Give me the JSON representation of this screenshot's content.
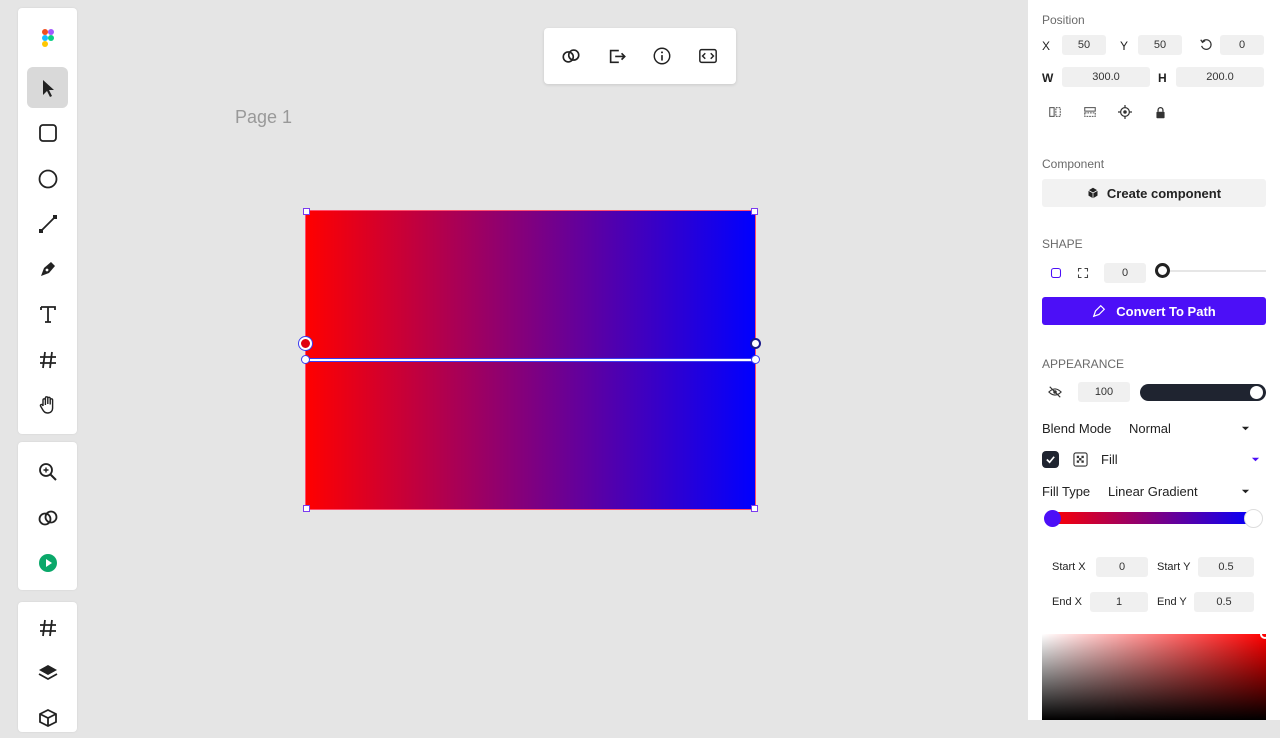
{
  "canvas": {
    "page_label": "Page 1"
  },
  "tools_top": [
    "logo-icon",
    "pointer-icon",
    "rectangle-icon",
    "ellipse-icon",
    "line-icon",
    "pen-icon",
    "text-icon",
    "frame-icon",
    "hand-icon"
  ],
  "tools_mid": [
    "zoom-icon",
    "link-icon",
    "play-icon"
  ],
  "tools_bottom": [
    "frame-icon",
    "layers-icon",
    "component-icon"
  ],
  "topbar": [
    "link-icon",
    "export-icon",
    "info-icon",
    "code-icon"
  ],
  "panel": {
    "position": {
      "title": "Position",
      "x_label": "X",
      "x_value": "50",
      "y_label": "Y",
      "y_value": "50",
      "rotation_value": "0",
      "w_label": "W",
      "w_value": "300.0",
      "h_label": "H",
      "h_value": "200.0"
    },
    "component": {
      "title": "Component",
      "button": "Create component"
    },
    "shape": {
      "title": "SHAPE",
      "radius_value": "0",
      "convert_button": "Convert To Path"
    },
    "appearance": {
      "title": "APPEARANCE",
      "opacity_value": "100",
      "blend_label": "Blend Mode",
      "blend_value": "Normal",
      "fill_label": "Fill",
      "fill_type_label": "Fill Type",
      "fill_type_value": "Linear Gradient",
      "start_x_label": "Start X",
      "start_x_value": "0",
      "start_y_label": "Start Y",
      "start_y_value": "0.5",
      "end_x_label": "End X",
      "end_x_value": "1",
      "end_y_label": "End Y",
      "end_y_value": "0.5"
    }
  },
  "colors": {
    "accent": "#4c0ff7",
    "gradient_start": "#ff0000",
    "gradient_end": "#0000ff"
  }
}
